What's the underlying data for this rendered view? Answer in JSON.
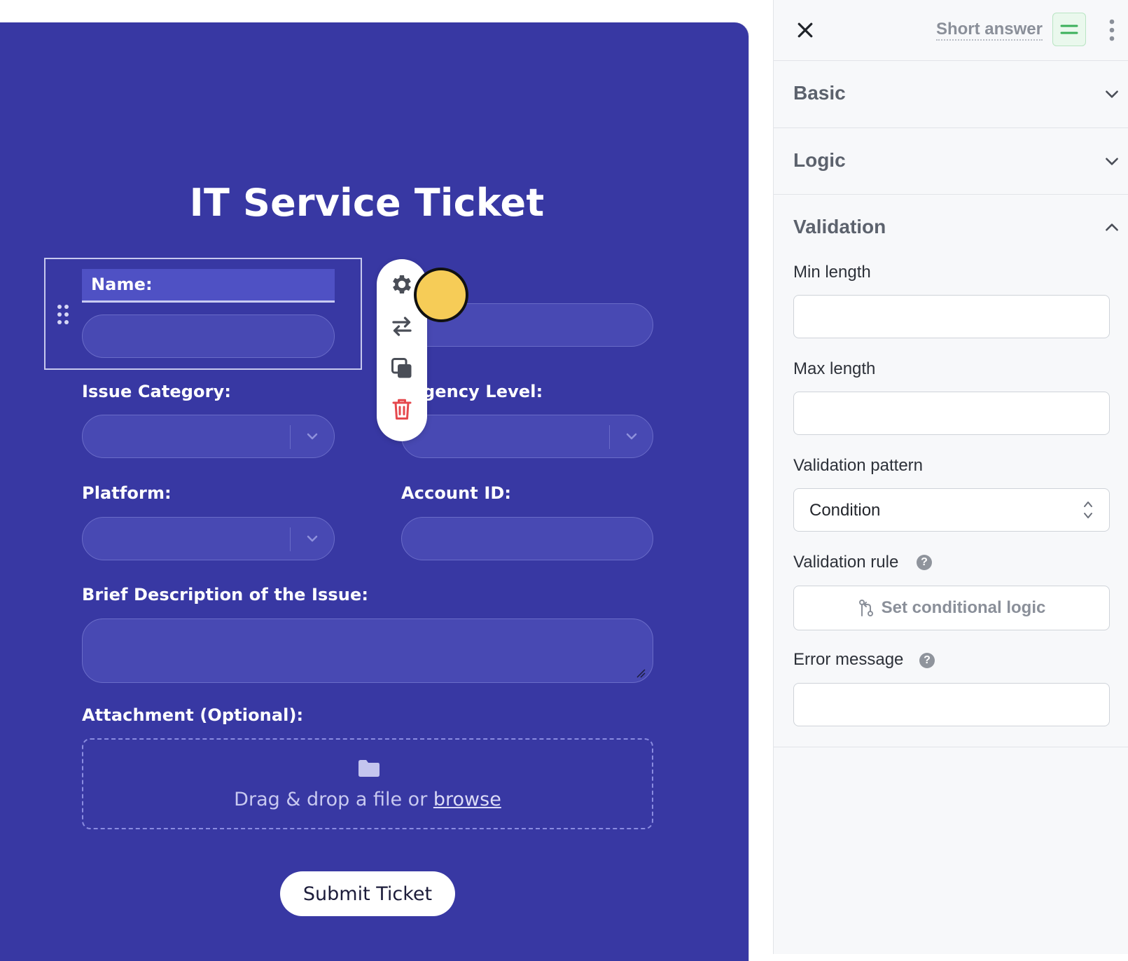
{
  "form": {
    "title": "IT Service Ticket",
    "fields": {
      "name_label": "Name:",
      "issue_category_label": "Issue Category:",
      "urgency_label": "gency Level:",
      "platform_label": "Platform:",
      "account_id_label": "Account ID:",
      "description_label": "Brief Description of the Issue:",
      "attachment_label": "Attachment (Optional):"
    },
    "dropzone": {
      "text": "Drag & drop a file or ",
      "link": "browse"
    },
    "submit_label": "Submit Ticket"
  },
  "toolbar": {
    "icons": [
      "gear-icon",
      "swap-icon",
      "duplicate-icon",
      "trash-icon"
    ]
  },
  "panel": {
    "field_type": "Short answer",
    "sections": {
      "basic": "Basic",
      "logic": "Logic",
      "validation": "Validation"
    },
    "validation": {
      "min_length_label": "Min length",
      "max_length_label": "Max length",
      "pattern_label": "Validation pattern",
      "pattern_value": "Condition",
      "rule_label": "Validation rule",
      "rule_button": "Set conditional logic",
      "error_label": "Error message",
      "help_glyph": "?"
    }
  },
  "colors": {
    "canvas_bg": "#3838a3",
    "field_bg": "#4849b3",
    "accent_green": "#3bb05a",
    "trash_red": "#e5484d",
    "cursor_yellow": "#f6cc57"
  }
}
